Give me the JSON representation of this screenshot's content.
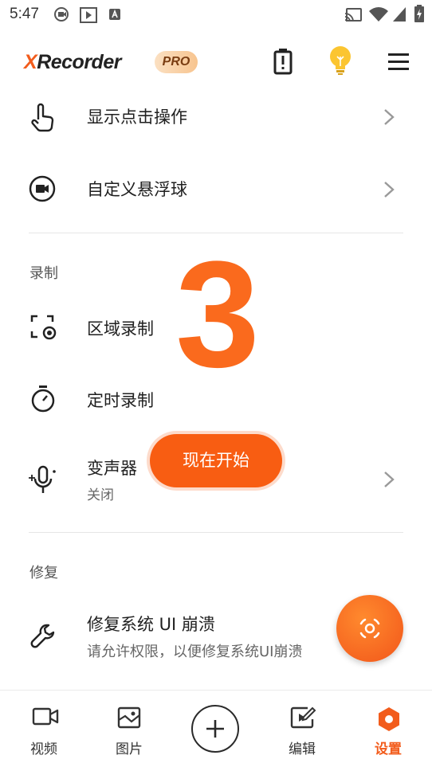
{
  "status_bar": {
    "time": "5:47"
  },
  "header": {
    "logo_x": "X",
    "logo_rest": "Recorder",
    "pro_badge": "PRO"
  },
  "settings": {
    "show_touches": "显示点击操作",
    "floating_ball": "自定义悬浮球",
    "record_section": "录制",
    "area_record": "区域录制",
    "timed_record": "定时录制",
    "voice_changer": "变声器",
    "voice_changer_status": "关闭",
    "repair_section": "修复",
    "repair_ui": "修复系统 UI 崩溃",
    "repair_ui_desc": "请允许权限，以便修复系统UI崩溃"
  },
  "overlay": {
    "countdown": "3",
    "start_now": "现在开始"
  },
  "bottom_nav": {
    "items": [
      {
        "label": "视频",
        "icon": "video-camera-icon"
      },
      {
        "label": "图片",
        "icon": "image-icon"
      },
      {
        "label": "",
        "icon": "plus-icon"
      },
      {
        "label": "编辑",
        "icon": "edit-video-icon"
      },
      {
        "label": "设置",
        "icon": "settings-hexagon-icon",
        "active": true
      }
    ]
  },
  "colors": {
    "accent": "#f25c1c",
    "fab": "#f85d12",
    "countdown": "#fa6a1d"
  }
}
